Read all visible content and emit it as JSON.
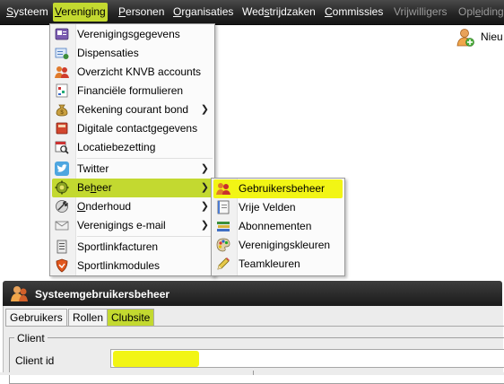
{
  "menubar": {
    "items": [
      {
        "label": "Systeem",
        "accel": "S",
        "rest": "ysteem"
      },
      {
        "label": "Vereniging",
        "accel": "V",
        "rest": "ereniging"
      },
      {
        "label": "Personen",
        "accel": "P",
        "rest": "ersonen"
      },
      {
        "label": "Organisaties",
        "accel": "O",
        "rest": "rganisaties"
      },
      {
        "label": "Wedstrijdzaken",
        "pre": "Wed",
        "accel": "s",
        "rest": "trijdzaken"
      },
      {
        "label": "Commissies",
        "accel": "C",
        "rest": "ommissies"
      },
      {
        "label": "Vrijwilligers"
      },
      {
        "label": "Opleidingen",
        "pre": "Opl",
        "accel": "e",
        "rest": "iding"
      }
    ]
  },
  "toolbar": {
    "nieuw_label": "Nieu"
  },
  "vereniging_menu": {
    "items": [
      {
        "label": "Verenigingsgegevens",
        "icon": "building-card-icon"
      },
      {
        "label": "Dispensaties",
        "icon": "dispensation-icon"
      },
      {
        "label": "Overzicht KNVB accounts",
        "icon": "people-icon"
      },
      {
        "label": "Financiële formulieren",
        "icon": "form-icon"
      },
      {
        "label": "Rekening courant bond",
        "icon": "money-bag-icon"
      },
      {
        "label": "Digitale contactgegevens",
        "icon": "address-book-icon"
      },
      {
        "label": "Locatiebezetting",
        "icon": "calendar-search-icon"
      },
      {
        "label": "Twitter",
        "icon": "twitter-icon"
      },
      {
        "label": "Beheer",
        "icon": "gear-icon",
        "accel": "h"
      },
      {
        "label": "Onderhoud",
        "icon": "wrench-globe-icon"
      },
      {
        "label": "Verenigings e-mail",
        "icon": "envelope-icon"
      },
      {
        "label": "Sportlinkfacturen",
        "icon": "invoice-icon"
      },
      {
        "label": "Sportlinkmodules",
        "icon": "shield-icon"
      }
    ]
  },
  "beheer_menu": {
    "items": [
      {
        "label": "Gebruikersbeheer",
        "icon": "users-icon"
      },
      {
        "label": "Vrije Velden",
        "icon": "notebook-icon"
      },
      {
        "label": "Abonnementen",
        "icon": "books-icon"
      },
      {
        "label": "Verenigingskleuren",
        "icon": "palette-icon"
      },
      {
        "label": "Teamkleuren",
        "icon": "pencil-icon"
      }
    ]
  },
  "window": {
    "title": "Systeemgebruikersbeheer",
    "tabs": [
      "Gebruikers",
      "Rollen",
      "Clubsite"
    ],
    "group_label": "Client",
    "field_label": "Client id",
    "field_value": ""
  },
  "colors": {
    "accent": "#c3d930",
    "highlight": "#f2f515",
    "menubar": "#262626"
  }
}
